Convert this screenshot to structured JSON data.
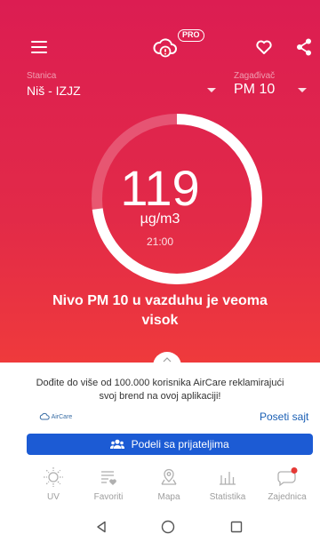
{
  "header": {
    "pro_badge": "PRO",
    "icons": [
      "menu-icon",
      "cloud-alert-icon",
      "heart-icon",
      "share-icon"
    ]
  },
  "station": {
    "label": "Stanica",
    "value": "Niš - IZJZ"
  },
  "pollutant": {
    "label": "Zagađivač",
    "value": "PM 10"
  },
  "reading": {
    "value": "119",
    "unit": "µg/m3",
    "time": "21:00",
    "gauge_fill_fraction": 0.73
  },
  "status": {
    "line1": "Nivo PM 10 u vazduhu je veoma",
    "line2": "visok"
  },
  "ad": {
    "text_line1": "Dođite do više od 100.000 korisnika AirCare reklamirajući",
    "text_line2": "svoj brend na ovoj aplikaciji!",
    "logo_text": "AirCare",
    "link": "Poseti sajt",
    "share_button": "Podeli sa prijateljima"
  },
  "nav": {
    "items": [
      {
        "label": "UV",
        "icon": "sun-icon"
      },
      {
        "label": "Favoriti",
        "icon": "favorites-list-icon"
      },
      {
        "label": "Mapa",
        "icon": "map-pin-icon"
      },
      {
        "label": "Statistika",
        "icon": "bar-chart-icon"
      },
      {
        "label": "Zajednica",
        "icon": "chat-icon"
      }
    ]
  },
  "colors": {
    "hero_top": "#dc1d52",
    "hero_bottom": "#ef3a3c",
    "accent_blue": "#1c5bd4",
    "notification_dot": "#e53935"
  }
}
